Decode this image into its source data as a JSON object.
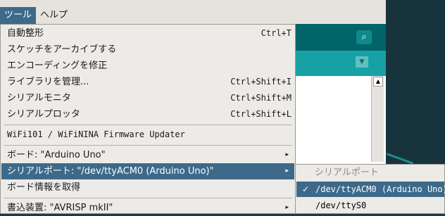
{
  "menubar": {
    "items": [
      {
        "label": "ツール",
        "active": true
      },
      {
        "label": "ヘルプ",
        "active": false
      }
    ]
  },
  "tools_menu": {
    "items": [
      {
        "label": "自動整形",
        "shortcut": "Ctrl+T"
      },
      {
        "label": "スケッチをアーカイブする",
        "shortcut": ""
      },
      {
        "label": "エンコーディングを修正",
        "shortcut": ""
      },
      {
        "label": "ライブラリを管理...",
        "shortcut": "Ctrl+Shift+I"
      },
      {
        "label": "シリアルモニタ",
        "shortcut": "Ctrl+Shift+M"
      },
      {
        "label": "シリアルプロッタ",
        "shortcut": "Ctrl+Shift+L"
      },
      {
        "label": "WiFi101 / WiFiNINA Firmware Updater",
        "shortcut": ""
      },
      {
        "label": "ボード: \"Arduino Uno\"",
        "shortcut": ""
      },
      {
        "label": "シリアルポート: \"/dev/ttyACM0 (Arduino Uno)\"",
        "shortcut": ""
      },
      {
        "label": "ボード情報を取得",
        "shortcut": ""
      },
      {
        "label": "書込装置: \"AVRISP mkII\"",
        "shortcut": ""
      }
    ],
    "submenu_arrow": "▸"
  },
  "port_submenu": {
    "header": "シリアルポート",
    "items": [
      {
        "label": "/dev/ttyACM0 (Arduino Uno)",
        "checked": true,
        "check": "✓"
      },
      {
        "label": "/dev/ttyS0",
        "checked": false,
        "check": ""
      }
    ]
  },
  "icons": {
    "serial_monitor": "magnifier-icon",
    "tab_dropdown": "triangle-down-icon",
    "scroll_up": "triangle-up-icon"
  },
  "colors": {
    "highlight": "#3d6a8a",
    "teal_dark": "#006468",
    "teal_light": "#17a1a5"
  }
}
